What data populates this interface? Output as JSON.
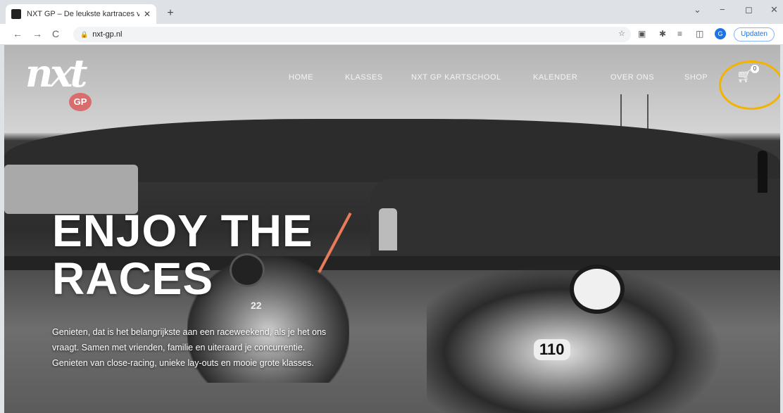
{
  "browser": {
    "tab_title": "NXT GP – De leukste kartraces v…",
    "tab_close": "✕",
    "new_tab": "+",
    "url": "nxt-gp.nl",
    "update_label": "Updaten",
    "profile_initial": "G",
    "window_min": "−",
    "window_max": "◻",
    "window_close": "✕",
    "back": "←",
    "forward": "→",
    "reload": "C",
    "menu": "⋮"
  },
  "site": {
    "logo_text": "nxt",
    "logo_badge": "GP",
    "nav": [
      "HOME",
      "KLASSES",
      "NXT GP KARTSCHOOL",
      "KALENDER",
      "OVER ONS",
      "SHOP"
    ],
    "cart_count": "0"
  },
  "hero": {
    "title_line1": "ENJOY THE",
    "title_line2": "RACES",
    "body": "Genieten, dat is het belangrijkste aan een raceweekend, als je het ons vraagt. Samen met vrienden, familie en uiteraard je concurrentie. Genieten van close-racing, unieke lay-outs en mooie grote klasses."
  },
  "kart_numbers": [
    "22",
    "110"
  ],
  "colors": {
    "highlight": "#f2b400",
    "accent_line": "#e97a5a",
    "logo_badge": "#d96c6c"
  }
}
